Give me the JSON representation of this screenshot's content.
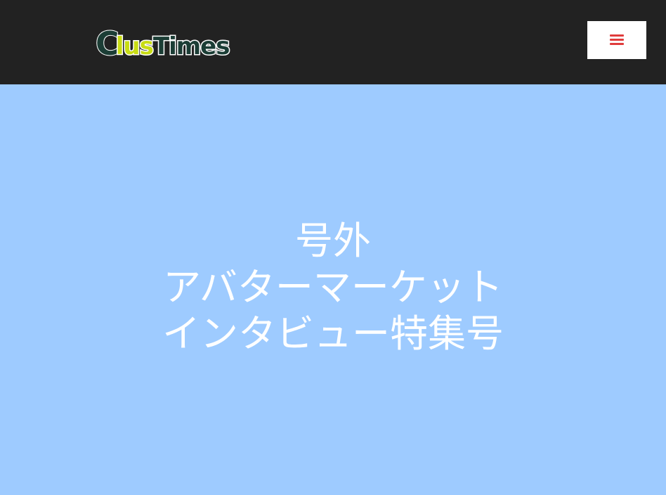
{
  "header": {
    "logo": {
      "part1": "C",
      "part2": "lus",
      "part3": "Times"
    },
    "menu_icon": "hamburger-menu-icon",
    "menu_icon_color": "#e03c3c"
  },
  "hero": {
    "lines": [
      "号外",
      "アバターマーケット",
      "インタビュー特集号"
    ]
  },
  "colors": {
    "header_bg": "#222222",
    "hero_bg": "#9ecbff",
    "logo_dark": "#1b3d35",
    "logo_accent": "#c8dc14"
  }
}
